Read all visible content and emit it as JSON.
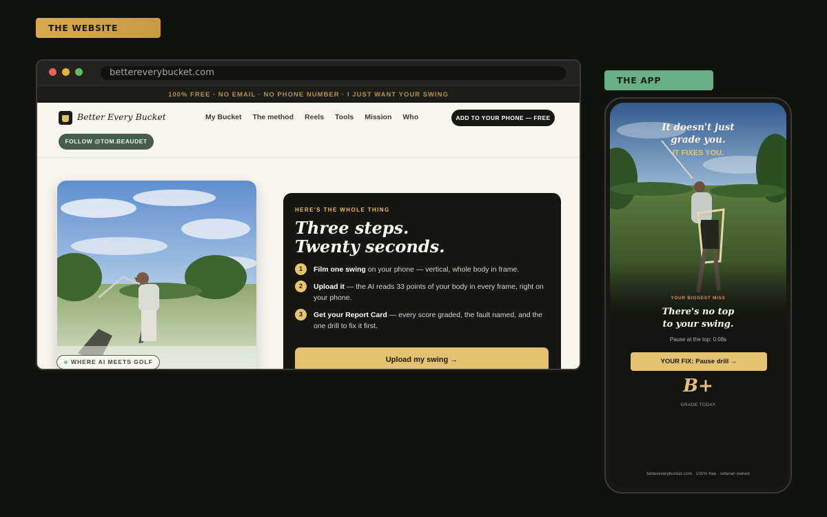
{
  "labels": {
    "website": "THE WEBSITE",
    "app": "THE APP"
  },
  "browser": {
    "url": "bettereverybucket.com"
  },
  "promo": "100% FREE · NO EMAIL · NO PHONE NUMBER · I JUST WANT YOUR SWING",
  "nav": {
    "logo": "Better Every Bucket",
    "links": [
      "My Bucket",
      "The method",
      "Reels",
      "Tools",
      "Mission",
      "Who"
    ],
    "cta": "ADD TO YOUR PHONE — FREE",
    "follow": "FOLLOW @TOM.BEAUDET"
  },
  "hero": {
    "badge": "WHERE AI MEETS GOLF"
  },
  "card": {
    "eyebrow": "HERE'S THE WHOLE THING",
    "headline_1": "Three steps.",
    "headline_2": "Twenty seconds.",
    "steps": [
      {
        "num": "1",
        "bold": "Film one swing",
        "text": " on your phone — vertical, whole body in frame."
      },
      {
        "num": "2",
        "bold": "Upload it",
        "text": " — the AI reads 33 points of your body in every frame, right on your phone."
      },
      {
        "num": "3",
        "bold": "Get your Report Card",
        "text": " — every score graded, the fault named, and the one drill to fix it first."
      }
    ],
    "button": "Upload my swing →"
  },
  "app": {
    "headline_1": "It doesn't just",
    "headline_2": "grade you.",
    "headline_accent": "IT FIXES YOU.",
    "miss_label": "YOUR BIGGEST MISS",
    "miss_1": "There's no top",
    "miss_2": "to your swing.",
    "pause": "Pause at the top: 0.08s",
    "fix_button": "YOUR FIX: Pause drill →",
    "grade": "B+",
    "grade_label": "GRADE TODAY",
    "footer": "bettereverybucket.com · 100% free · veteran owned"
  },
  "colors": {
    "background": "#101210",
    "gold": "#e3c170",
    "green": "#6aae84",
    "dark_card": "#161612"
  }
}
